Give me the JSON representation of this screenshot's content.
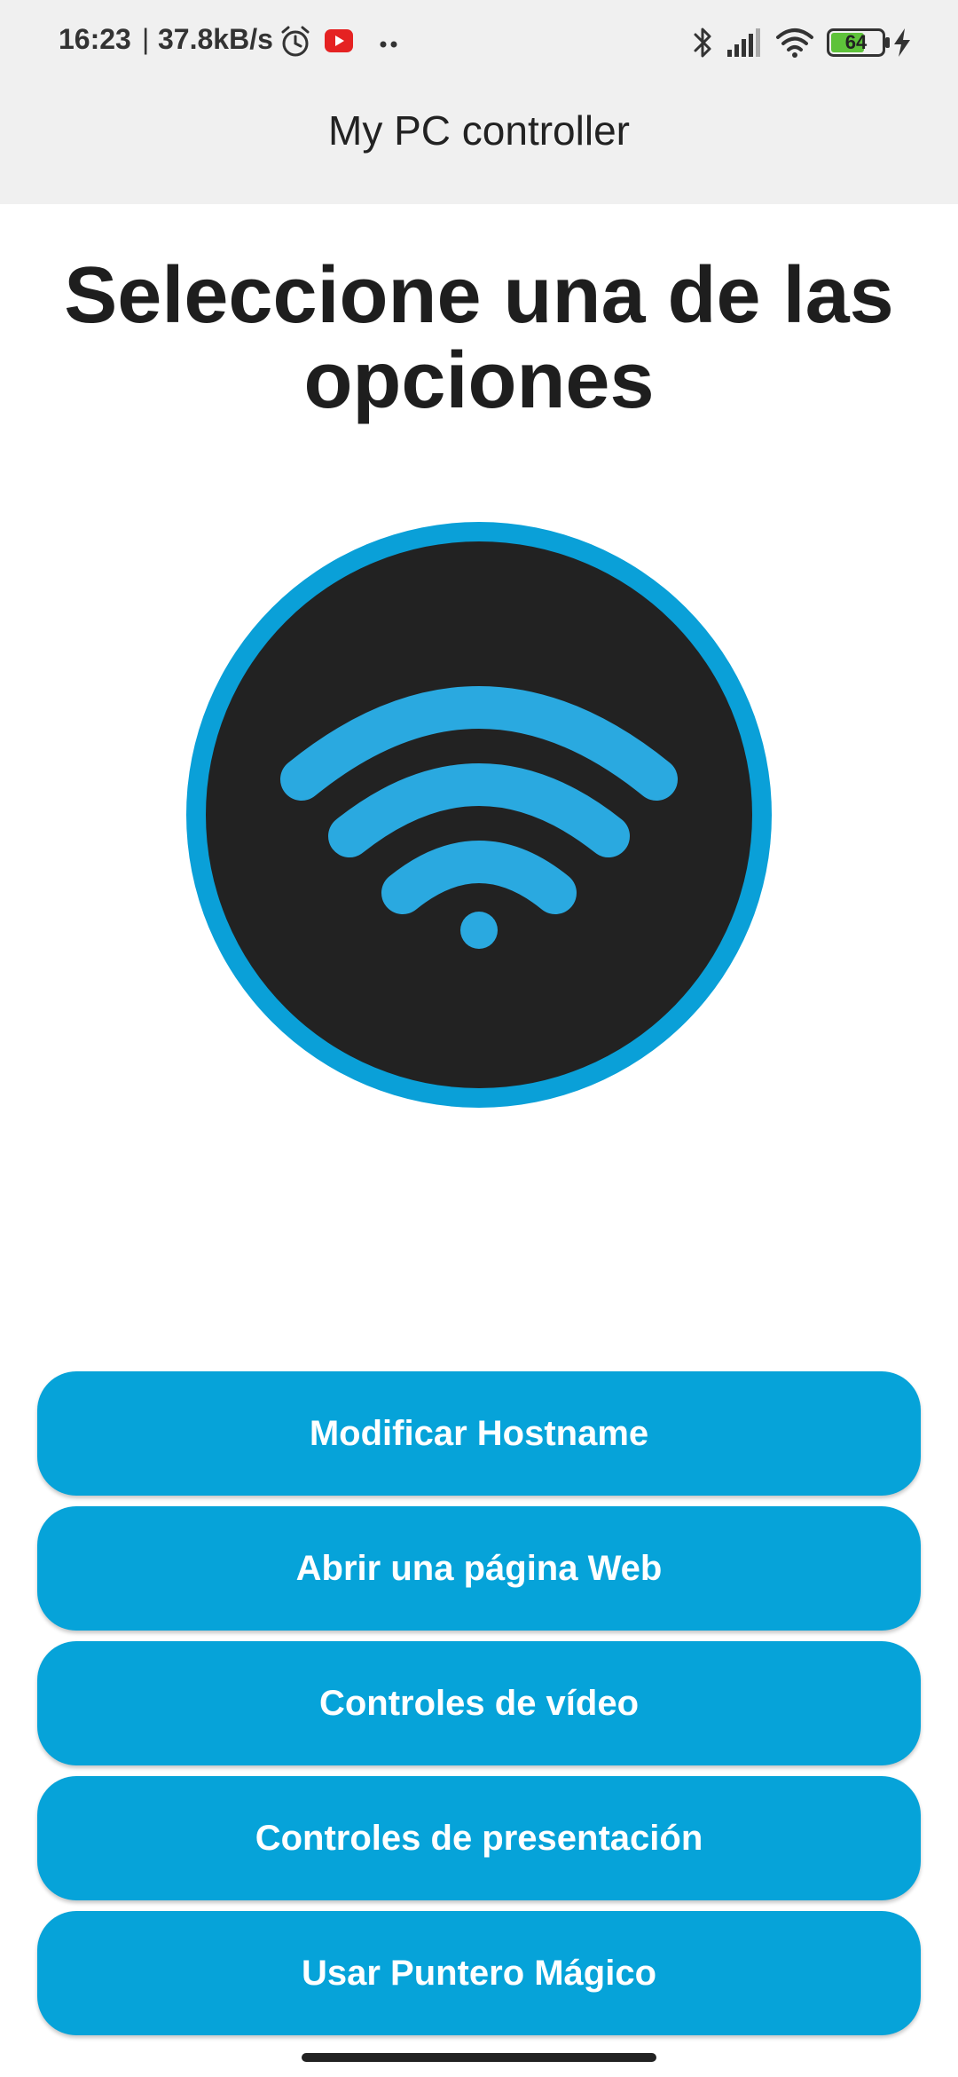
{
  "status_bar": {
    "time": "16:23",
    "separator": "|",
    "net_speed": "37.8kB/s",
    "battery_level": "64",
    "icons": [
      "alarm-icon",
      "youtube-icon",
      "more-dots-icon",
      "bluetooth-icon",
      "signal-icon",
      "wifi-icon",
      "battery-icon",
      "charging-icon"
    ]
  },
  "app_bar": {
    "title": "My PC controller"
  },
  "main": {
    "heading": "Seleccione una de las opciones",
    "logo_icon": "wifi-icon",
    "buttons": [
      {
        "label": "Modificar Hostname"
      },
      {
        "label": "Abrir una página Web"
      },
      {
        "label": "Controles de vídeo"
      },
      {
        "label": "Controles de presentación"
      },
      {
        "label": "Usar Puntero Mágico"
      }
    ]
  },
  "colors": {
    "accent": "#06a3d9",
    "logo_ring": "#0aa0d8",
    "logo_fill": "#222222",
    "wifi_arcs": "#2aa9e0",
    "app_bar_bg": "#f0f0f0"
  }
}
